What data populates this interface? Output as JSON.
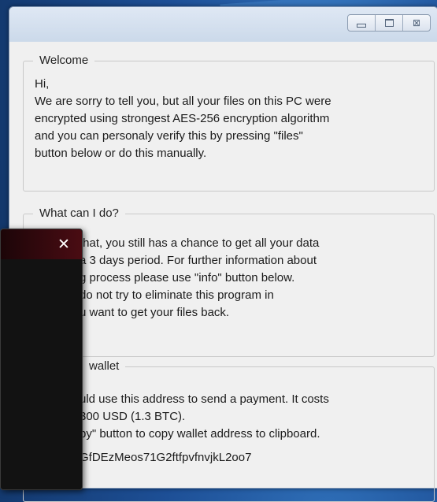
{
  "window": {
    "controls": {
      "minimize_icon": "minimize-icon",
      "maximize_icon": "maximize-icon",
      "close_icon": "close-icon",
      "close_glyph": "⊠"
    }
  },
  "groups": {
    "welcome": {
      "title": "Welcome",
      "lines": [
        "Hi,",
        "We are sorry to tell you, but  all your files on this PC were",
        "encrypted using strongest AES-256 encryption algorithm",
        "and you can personaly verify this by pressing  \"files\"",
        "button below or do this manually."
      ]
    },
    "what": {
      "title": "What can I do?",
      "lines": [
        " that, you still has a chance to get all your data",
        "a 3 days period. For further information about",
        "g process please use \"info\" button below.",
        "do not try to eliminate this program in",
        "u want to get your files back."
      ]
    },
    "wallet": {
      "title": "wallet",
      "lines": [
        "uld use this address to send a payment. It costs",
        "300 USD (1.3 BTC).",
        "py\" button to copy wallet address to clipboard."
      ],
      "address": "GfDEzMeos71G2ftfpvfnvjkL2oo7"
    }
  },
  "popup": {
    "close_glyph": "✕"
  },
  "colors": {
    "desktop": "#1d4f96",
    "window_bg": "#f0f0f0",
    "popup_bg": "#121212",
    "popup_bar": "#4a0c13"
  }
}
